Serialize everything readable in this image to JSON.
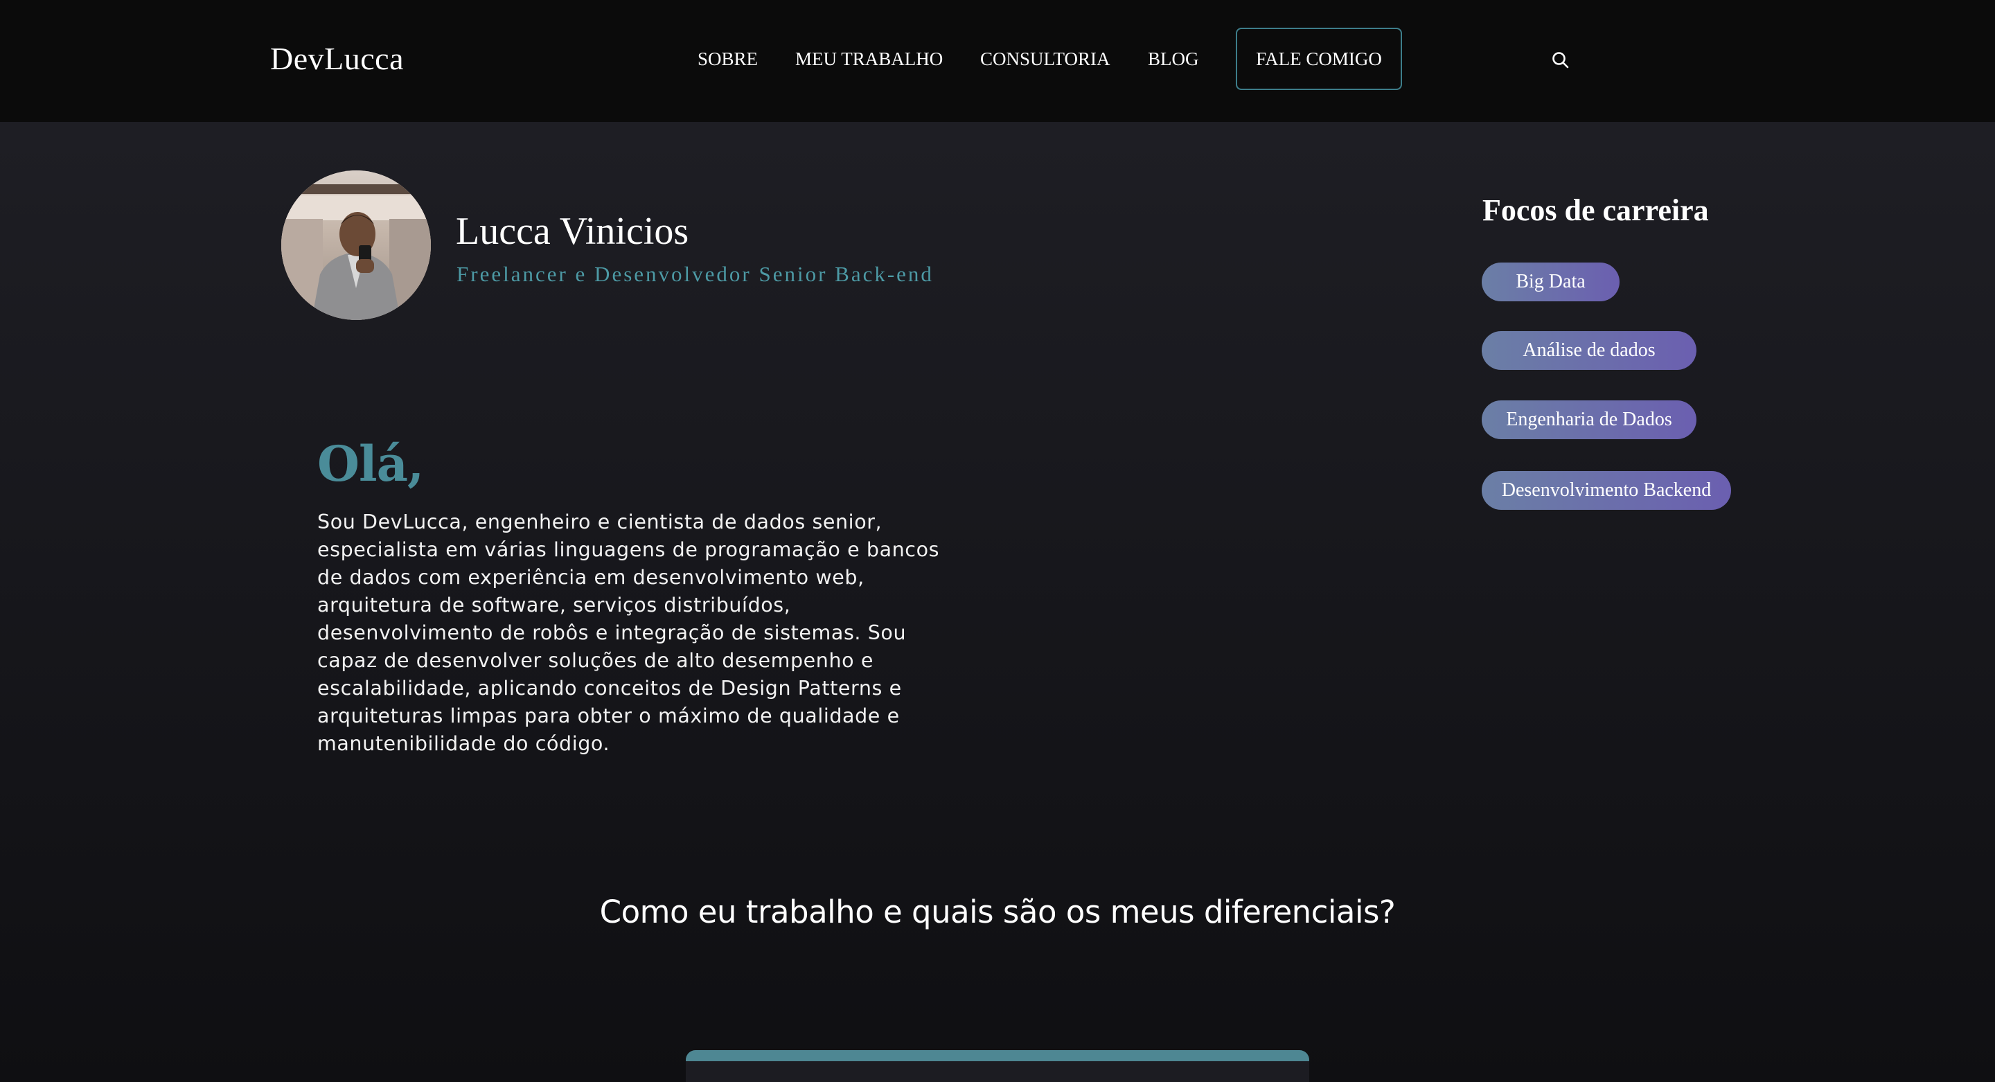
{
  "header": {
    "logo": "DevLucca",
    "nav": {
      "sobre": "SOBRE",
      "trabalho": "MEU TRABALHO",
      "consultoria": "CONSULTORIA",
      "blog": "BLOG"
    },
    "cta": "FALE COMIGO",
    "search_icon": "search-icon"
  },
  "profile": {
    "name": "Lucca Vinicios",
    "role": "Freelancer e Desenvolvedor Senior Back-end"
  },
  "intro": {
    "greeting": "Olá,",
    "text": "Sou DevLucca, engenheiro e cientista de dados senior, especialista em várias linguagens de programação e bancos de dados com experiência em desenvolvimento web, arquitetura de software, serviços distribuídos, desenvolvimento de robôs e integração de sistemas. Sou capaz de desenvolver soluções de alto desempenho e escalabilidade, aplicando conceitos de Design Patterns e arquiteturas limpas para obter o máximo de qualidade e manutenibilidade do código."
  },
  "focus": {
    "title": "Focos de carreira",
    "items": [
      "Big Data",
      "Análise de dados",
      "Engenharia de Dados",
      "Desenvolvimento Backend"
    ]
  },
  "work": {
    "title": "Como eu trabalho e quais são os meus diferenciais?"
  },
  "colors": {
    "accent": "#4a8c99",
    "chip_start": "#6b7fa6",
    "chip_end": "#6b5fb0",
    "header_bg": "#0b0b0b",
    "page_bg": "#131217"
  }
}
